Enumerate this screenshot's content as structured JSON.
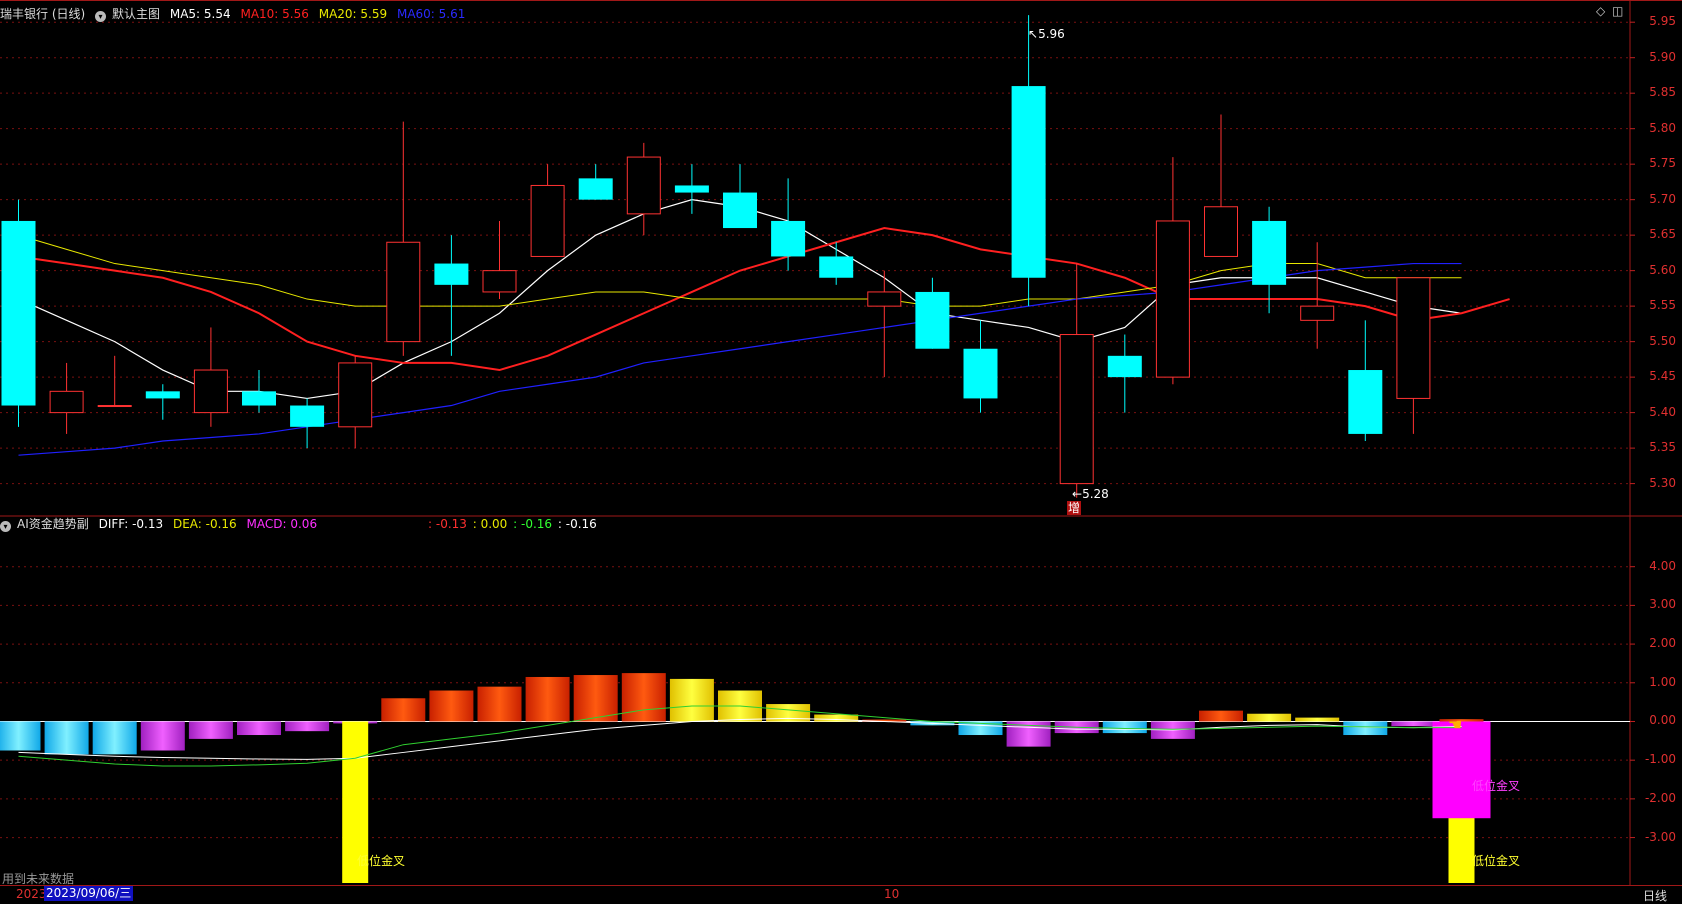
{
  "main_header": {
    "title": "瑞丰银行 (日线)",
    "layout": "默认主图",
    "ma5": "MA5: 5.54",
    "ma10": "MA10: 5.56",
    "ma20": "MA20: 5.59",
    "ma60": "MA60: 5.61"
  },
  "sub_header": {
    "title": "AI资金趋势副",
    "diff": "DIFF: -0.13",
    "dea": "DEA: -0.16",
    "macd": "MACD: 0.06",
    "v1": ": -0.13",
    "v2": ": 0.00",
    "v3": ": -0.16",
    "v4": ": -0.16"
  },
  "annotations": {
    "high": "5.96",
    "low": "5.28",
    "zeng": "增",
    "cross_yellow_1": "低位金叉",
    "cross_yellow_2": "低位金叉",
    "cross_magenta": "低位金叉"
  },
  "footer": {
    "note": "用到未来数据",
    "year": "2023",
    "date": "2023/09/06/三",
    "month": "10",
    "period": "日线"
  },
  "colors": {
    "up": "#ff3232",
    "down": "#00ffff",
    "ma5": "#ffffff",
    "ma10": "#ff2020",
    "ma20": "#e8e800",
    "ma60": "#2020ff",
    "macd": "#ff00ff",
    "axis": "#e03030"
  },
  "chart_data": [
    {
      "type": "candlestick",
      "title": "瑞丰银行 (日线)",
      "ylim": [
        5.26,
        5.97
      ],
      "yticks": [
        "5.95",
        "5.90",
        "5.85",
        "5.80",
        "5.75",
        "5.70",
        "5.65",
        "5.60",
        "5.55",
        "5.50",
        "5.45",
        "5.40",
        "5.35",
        "5.30"
      ],
      "candles": [
        {
          "o": 5.67,
          "h": 5.7,
          "l": 5.38,
          "c": 5.41
        },
        {
          "o": 5.4,
          "h": 5.47,
          "l": 5.37,
          "c": 5.43
        },
        {
          "o": 5.41,
          "h": 5.48,
          "l": 5.41,
          "c": 5.41
        },
        {
          "o": 5.43,
          "h": 5.44,
          "l": 5.39,
          "c": 5.42
        },
        {
          "o": 5.4,
          "h": 5.52,
          "l": 5.38,
          "c": 5.46
        },
        {
          "o": 5.43,
          "h": 5.46,
          "l": 5.4,
          "c": 5.41
        },
        {
          "o": 5.41,
          "h": 5.42,
          "l": 5.35,
          "c": 5.38
        },
        {
          "o": 5.38,
          "h": 5.48,
          "l": 5.35,
          "c": 5.47
        },
        {
          "o": 5.5,
          "h": 5.81,
          "l": 5.48,
          "c": 5.64
        },
        {
          "o": 5.61,
          "h": 5.65,
          "l": 5.48,
          "c": 5.58
        },
        {
          "o": 5.57,
          "h": 5.67,
          "l": 5.56,
          "c": 5.6
        },
        {
          "o": 5.62,
          "h": 5.75,
          "l": 5.62,
          "c": 5.72
        },
        {
          "o": 5.73,
          "h": 5.75,
          "l": 5.7,
          "c": 5.7
        },
        {
          "o": 5.68,
          "h": 5.78,
          "l": 5.65,
          "c": 5.76
        },
        {
          "o": 5.72,
          "h": 5.75,
          "l": 5.68,
          "c": 5.71
        },
        {
          "o": 5.71,
          "h": 5.75,
          "l": 5.66,
          "c": 5.66
        },
        {
          "o": 5.67,
          "h": 5.73,
          "l": 5.6,
          "c": 5.62
        },
        {
          "o": 5.62,
          "h": 5.64,
          "l": 5.58,
          "c": 5.59
        },
        {
          "o": 5.55,
          "h": 5.6,
          "l": 5.45,
          "c": 5.57
        },
        {
          "o": 5.57,
          "h": 5.59,
          "l": 5.49,
          "c": 5.49
        },
        {
          "o": 5.49,
          "h": 5.53,
          "l": 5.4,
          "c": 5.42
        },
        {
          "o": 5.86,
          "h": 5.96,
          "l": 5.55,
          "c": 5.59
        },
        {
          "o": 5.3,
          "h": 5.61,
          "l": 5.28,
          "c": 5.51
        },
        {
          "o": 5.48,
          "h": 5.51,
          "l": 5.4,
          "c": 5.45
        },
        {
          "o": 5.45,
          "h": 5.76,
          "l": 5.44,
          "c": 5.67
        },
        {
          "o": 5.62,
          "h": 5.82,
          "l": 5.62,
          "c": 5.69
        },
        {
          "o": 5.67,
          "h": 5.69,
          "l": 5.54,
          "c": 5.58
        },
        {
          "o": 5.53,
          "h": 5.64,
          "l": 5.49,
          "c": 5.55
        },
        {
          "o": 5.46,
          "h": 5.53,
          "l": 5.36,
          "c": 5.37
        },
        {
          "o": 5.42,
          "h": 5.59,
          "l": 5.37,
          "c": 5.59
        }
      ],
      "series": [
        {
          "name": "MA5",
          "values": [
            5.56,
            5.53,
            5.5,
            5.46,
            5.43,
            5.43,
            5.42,
            5.43,
            5.47,
            5.5,
            5.54,
            5.6,
            5.65,
            5.68,
            5.7,
            5.69,
            5.67,
            5.63,
            5.59,
            5.54,
            5.53,
            5.52,
            5.5,
            5.52,
            5.58,
            5.59,
            5.59,
            5.59,
            5.57,
            5.55,
            5.54
          ]
        },
        {
          "name": "MA10",
          "values": [
            5.62,
            5.61,
            5.6,
            5.59,
            5.57,
            5.54,
            5.5,
            5.48,
            5.47,
            5.47,
            5.46,
            5.48,
            5.51,
            5.54,
            5.57,
            5.6,
            5.62,
            5.64,
            5.66,
            5.65,
            5.63,
            5.62,
            5.61,
            5.59,
            5.56,
            5.56,
            5.56,
            5.56,
            5.55,
            5.53,
            5.54,
            5.56
          ]
        },
        {
          "name": "MA20",
          "values": [
            5.65,
            5.63,
            5.61,
            5.6,
            5.59,
            5.58,
            5.56,
            5.55,
            5.55,
            5.55,
            5.55,
            5.56,
            5.57,
            5.57,
            5.56,
            5.56,
            5.56,
            5.56,
            5.56,
            5.55,
            5.55,
            5.56,
            5.56,
            5.57,
            5.58,
            5.6,
            5.61,
            5.61,
            5.59,
            5.59,
            5.59
          ]
        },
        {
          "name": "MA60",
          "values": [
            5.34,
            5.345,
            5.35,
            5.36,
            5.365,
            5.37,
            5.38,
            5.39,
            5.4,
            5.41,
            5.43,
            5.44,
            5.45,
            5.47,
            5.48,
            5.49,
            5.5,
            5.51,
            5.52,
            5.53,
            5.54,
            5.55,
            5.56,
            5.565,
            5.57,
            5.58,
            5.59,
            5.6,
            5.605,
            5.61,
            5.61
          ]
        }
      ]
    },
    {
      "type": "bar",
      "title": "AI资金趋势副",
      "ylim": [
        -4.2,
        5.0
      ],
      "yticks": [
        "4.00",
        "3.00",
        "2.00",
        "1.00",
        "0.00",
        "-1.00",
        "-2.00",
        "-3.00"
      ],
      "macd": [
        -0.75,
        -0.85,
        -0.85,
        -0.75,
        -0.45,
        -0.35,
        -0.25,
        -0.05,
        0.6,
        0.8,
        0.9,
        1.15,
        1.2,
        1.25,
        1.1,
        0.8,
        0.45,
        0.18,
        0.05,
        -0.1,
        -0.35,
        -0.65,
        -0.3,
        -0.3,
        -0.45,
        0.28,
        0.2,
        0.1,
        -0.35,
        -0.12,
        0.06
      ],
      "extra_bars": [
        {
          "index": 7,
          "value": -4.5,
          "color": "yellow"
        },
        {
          "index": 30,
          "value": -2.5,
          "color": "magenta"
        },
        {
          "index": 30,
          "value": -4.5,
          "color": "yellow"
        }
      ],
      "series": [
        {
          "name": "DIFF",
          "values": [
            -0.8,
            -0.85,
            -0.9,
            -0.93,
            -0.95,
            -0.97,
            -0.98,
            -0.95,
            -0.8,
            -0.65,
            -0.5,
            -0.35,
            -0.2,
            -0.1,
            0.0,
            0.05,
            0.08,
            0.05,
            0.0,
            -0.05,
            -0.1,
            -0.15,
            -0.2,
            -0.2,
            -0.22,
            -0.15,
            -0.1,
            -0.08,
            -0.15,
            -0.16,
            -0.13
          ]
        },
        {
          "name": "DEA",
          "values": [
            -0.9,
            -1.0,
            -1.1,
            -1.15,
            -1.15,
            -1.12,
            -1.08,
            -0.95,
            -0.6,
            -0.45,
            -0.3,
            -0.1,
            0.1,
            0.3,
            0.4,
            0.4,
            0.3,
            0.2,
            0.1,
            0.0,
            -0.05,
            -0.1,
            -0.15,
            -0.18,
            -0.2,
            -0.18,
            -0.15,
            -0.12,
            -0.14,
            -0.16,
            -0.16
          ]
        }
      ]
    }
  ]
}
